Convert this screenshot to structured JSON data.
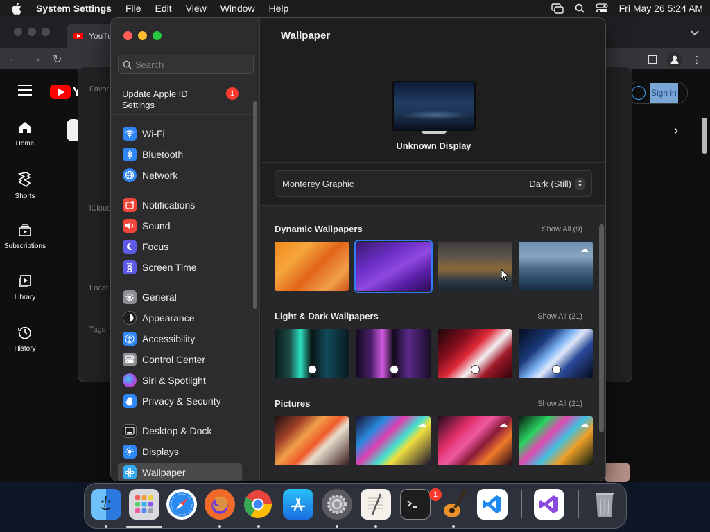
{
  "menubar": {
    "app_name": "System Settings",
    "menus": [
      "File",
      "Edit",
      "View",
      "Window",
      "Help"
    ],
    "datetime": "Fri May 26  5:24 AM"
  },
  "browser": {
    "tab_title": "YouTu",
    "logo_fragment": "Y",
    "sign_in": "Sign in",
    "guide": [
      {
        "label": "Home",
        "icon": "home-icon"
      },
      {
        "label": "Shorts",
        "icon": "shorts-icon"
      },
      {
        "label": "Subscriptions",
        "icon": "subscriptions-icon"
      },
      {
        "label": "Library",
        "icon": "library-icon"
      },
      {
        "label": "History",
        "icon": "history-icon"
      }
    ]
  },
  "finder": {
    "sidebar": [
      "Favor",
      "iCloud",
      "Locat",
      "Tags"
    ]
  },
  "settings": {
    "search_placeholder": "Search",
    "apple_id": {
      "label": "Update Apple ID Settings",
      "badge": "1"
    },
    "sidebar_items": [
      {
        "label": "Wi-Fi",
        "icon": "wifi-icon",
        "color": "#2f86f6"
      },
      {
        "label": "Bluetooth",
        "icon": "bluetooth-icon",
        "color": "#2f86f6"
      },
      {
        "label": "Network",
        "icon": "network-icon",
        "color": "#2f86f6"
      },
      {
        "label": "Notifications",
        "icon": "notifications-icon",
        "color": "#f0453a"
      },
      {
        "label": "Sound",
        "icon": "sound-icon",
        "color": "#f0453a"
      },
      {
        "label": "Focus",
        "icon": "focus-icon",
        "color": "#5e5ce6"
      },
      {
        "label": "Screen Time",
        "icon": "screen-time-icon",
        "color": "#5e5ce6"
      },
      {
        "label": "General",
        "icon": "gear-icon",
        "color": "#8e8e93"
      },
      {
        "label": "Appearance",
        "icon": "appearance-icon",
        "color": "#1c1c1e"
      },
      {
        "label": "Accessibility",
        "icon": "accessibility-icon",
        "color": "#2f86f6"
      },
      {
        "label": "Control Center",
        "icon": "control-center-icon",
        "color": "#8e8e93"
      },
      {
        "label": "Siri & Spotlight",
        "icon": "siri-icon",
        "color": "#b04bd9"
      },
      {
        "label": "Privacy & Security",
        "icon": "hand-icon",
        "color": "#2f86f6"
      },
      {
        "label": "Desktop & Dock",
        "icon": "dock-icon",
        "color": "#1c1c1e"
      },
      {
        "label": "Displays",
        "icon": "displays-icon",
        "color": "#2f86f6"
      },
      {
        "label": "Wallpaper",
        "icon": "wallpaper-icon",
        "color": "#35aaf0"
      }
    ],
    "active_item": "Wallpaper",
    "content": {
      "title": "Wallpaper",
      "display_name": "Unknown Display",
      "current_wallpaper": "Monterey Graphic",
      "appearance_mode": "Dark (Still)",
      "sections": [
        {
          "title": "Dynamic Wallpapers",
          "show_all": "Show All (9)"
        },
        {
          "title": "Light & Dark Wallpapers",
          "show_all": "Show All (21)"
        },
        {
          "title": "Pictures",
          "show_all": "Show All (21)"
        }
      ]
    }
  },
  "dock": {
    "apps": [
      "Finder",
      "Launchpad",
      "Safari",
      "Firefox",
      "Chrome",
      "App Store",
      "System Settings",
      "TextEdit",
      "Terminal",
      "GarageBand",
      "Visual Studio Code",
      "Visual Studio",
      "Trash"
    ],
    "settings_badge": "1"
  }
}
